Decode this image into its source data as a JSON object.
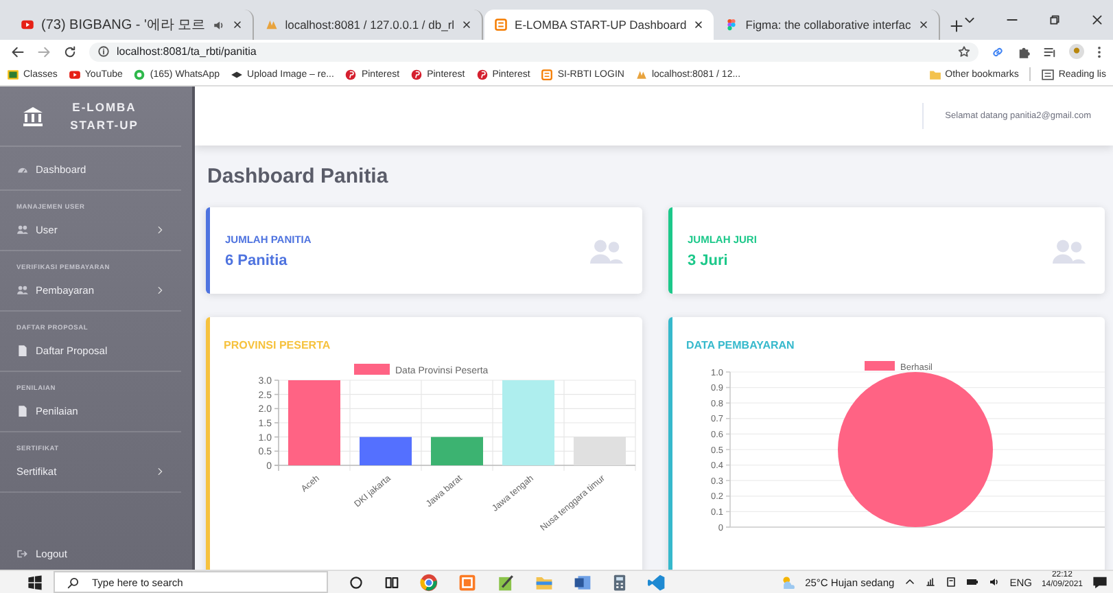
{
  "browser": {
    "tabs": [
      {
        "title": "(73) BIGBANG - '에라 모르",
        "selected": false
      },
      {
        "title": "localhost:8081 / 127.0.0.1 / db_rl",
        "selected": false
      },
      {
        "title": "E-LOMBA START-UP Dashboard",
        "selected": true
      },
      {
        "title": "Figma: the collaborative interfac",
        "selected": false
      }
    ],
    "address": "localhost:8081/ta_rbti/panitia",
    "bookmarks": [
      "Classes",
      "YouTube",
      "(165) WhatsApp",
      "Upload Image – re...",
      "Pinterest",
      "Pinterest",
      "Pinterest",
      "SI-RBTI LOGIN",
      "localhost:8081 / 12..."
    ],
    "other_bookmarks": "Other bookmarks",
    "reading_list": "Reading lis"
  },
  "sidebar": {
    "brand": "E-LOMBA START-UP",
    "items": [
      {
        "kind": "link",
        "label": "Dashboard",
        "has_submenu": false
      },
      {
        "kind": "heading",
        "label": "MANAJEMEN USER"
      },
      {
        "kind": "link",
        "label": "User",
        "has_submenu": true
      },
      {
        "kind": "heading",
        "label": "VERIFIKASI PEMBAYARAN"
      },
      {
        "kind": "link",
        "label": "Pembayaran",
        "has_submenu": true
      },
      {
        "kind": "heading",
        "label": "DAFTAR PROPOSAL"
      },
      {
        "kind": "link",
        "label": "Daftar Proposal",
        "has_submenu": false
      },
      {
        "kind": "heading",
        "label": "PENILAIAN"
      },
      {
        "kind": "link",
        "label": "Penilaian",
        "has_submenu": false
      },
      {
        "kind": "heading",
        "label": "SERTIFIKAT"
      },
      {
        "kind": "link",
        "label": "Sertifikat",
        "has_submenu": true
      },
      {
        "kind": "link",
        "label": "Logout",
        "has_submenu": false
      }
    ]
  },
  "topbar": {
    "greeting": "Selamat datang panitia2@gmail.com"
  },
  "page_title": "Dashboard Panitia",
  "stat_cards": [
    {
      "label": "JUMLAH PANITIA",
      "value": "6 Panitia",
      "color": "#4e73df"
    },
    {
      "label": "JUMLAH JURI",
      "value": "3 Juri",
      "color": "#1cc88a"
    }
  ],
  "chart_cards": [
    {
      "title": "PROVINSI PESERTA",
      "color": "#f6c23e",
      "chart_data": {
        "type": "bar",
        "categories": [
          "Aceh",
          "DKI jakarta",
          "Jawa barat",
          "Jawa tengah",
          "Nusa tenggara timur"
        ],
        "series": [
          {
            "name": "Data Provinsi Peserta",
            "color": "#ff6384",
            "colors": [
              "#ff6384",
              "#5470ff",
              "#3cb371",
              "#aeeeee",
              "#e0e0e0"
            ],
            "values": [
              3,
              1,
              1,
              3,
              1
            ]
          }
        ],
        "grid": true,
        "ylim": [
          0,
          3
        ],
        "yticks": [
          0,
          0.5,
          {
            "value": 1,
            "label": "1.0"
          },
          1.5,
          {
            "value": 2,
            "label": "2.0"
          },
          2.5,
          {
            "value": 3,
            "label": "3.0"
          }
        ]
      }
    },
    {
      "title": "DATA PEMBAYARAN",
      "color": "#36b9cc",
      "axis_labels": [
        "1.0",
        "0.9",
        "0.8",
        "0.7",
        "0.6",
        "0.5",
        "0.4",
        "0.3",
        "0.2",
        "0.1",
        "0"
      ],
      "chart_data": {
        "type": "pie",
        "series": [
          {
            "name": "Berhasil",
            "color": "#ff6384",
            "values": [
              1
            ]
          }
        ]
      }
    }
  ],
  "taskbar": {
    "search": {
      "placeholder": "Type here to search"
    },
    "weather": "25°C Hujan sedang",
    "language": "ENG",
    "time": "22:12",
    "date": "14/09/2021"
  }
}
